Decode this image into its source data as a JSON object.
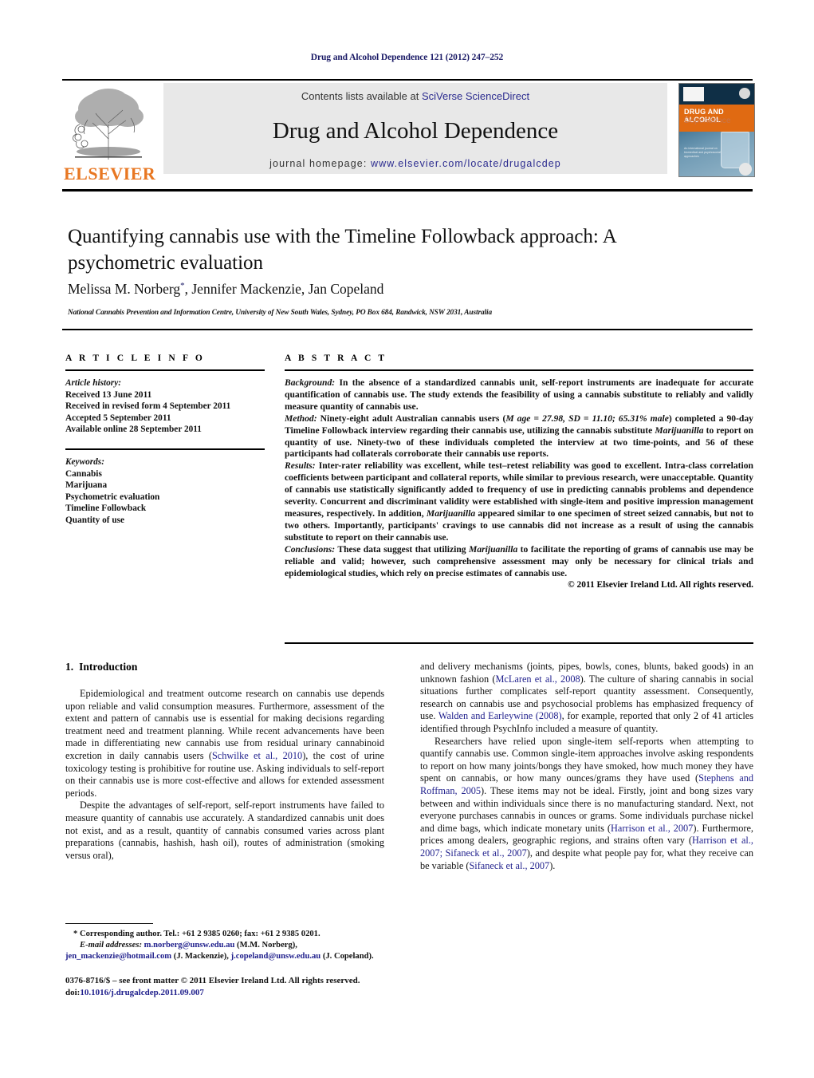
{
  "running_head": "Drug and Alcohol Dependence 121 (2012) 247–252",
  "masthead": {
    "contents_prefix": "Contents lists available at ",
    "contents_link": "SciVerse ScienceDirect",
    "journal_title": "Drug and Alcohol Dependence",
    "homepage_prefix": "journal homepage: ",
    "homepage_url": "www.elsevier.com/locate/drugalcdep",
    "publisher_logo_text": "ELSEVIER",
    "logo_icon": "elsevier-tree-icon"
  },
  "cover": {
    "title": "DRUG AND ALCOHOL",
    "subtitle": "Dependence",
    "small_text": "An international journal on biomedical and psychosocial approaches"
  },
  "article": {
    "title": "Quantifying cannabis use with the Timeline Followback approach: A psychometric evaluation",
    "authors": "Melissa M. Norberg",
    "authors_rest": ", Jennifer Mackenzie, Jan Copeland",
    "corresponding_marker": "*",
    "affiliation": "National Cannabis Prevention and Information Centre, University of New South Wales, Sydney, PO Box 684, Randwick, NSW 2031, Australia"
  },
  "info": {
    "heading": "A R T I C L E   I N F O",
    "history_label": "Article history:",
    "history": [
      "Received 13 June 2011",
      "Received in revised form 4 September 2011",
      "Accepted 5 September 2011",
      "Available online 28 September 2011"
    ],
    "keywords_label": "Keywords:",
    "keywords": [
      "Cannabis",
      "Marijuana",
      "Psychometric evaluation",
      "Timeline Followback",
      "Quantity of use"
    ]
  },
  "abstract": {
    "heading": "A B S T R A C T",
    "background_label": "Background:",
    "background": " In the absence of a standardized cannabis unit, self-report instruments are inadequate for accurate quantification of cannabis use. The study extends the feasibility of using a cannabis substitute to reliably and validly measure quantity of cannabis use.",
    "method_label": "Method:",
    "method_part1": " Ninety-eight adult Australian cannabis users (",
    "method_stats": "M age = 27.98, SD = 11.10; 65.31% male",
    "method_part2": ") completed a 90-day Timeline Followback interview regarding their cannabis use, utilizing the cannabis substitute ",
    "method_brand": "Marijuanilla",
    "method_part3": " to report on quantity of use. Ninety-two of these individuals completed the interview at two time-points, and 56 of these participants had collaterals corroborate their cannabis use reports.",
    "results_label": "Results:",
    "results_part1": " Inter-rater reliability was excellent, while test–retest reliability was good to excellent. Intra-class correlation coefficients between participant and collateral reports, while similar to previous research, were unacceptable. Quantity of cannabis use statistically significantly added to frequency of use in predicting cannabis problems and dependence severity. Concurrent and discriminant validity were established with single-item and positive impression management measures, respectively. In addition, ",
    "results_brand": "Marijuanilla",
    "results_part2": " appeared similar to one specimen of street seized cannabis, but not to two others. Importantly, participants' cravings to use cannabis did not increase as a result of using the cannabis substitute to report on their cannabis use.",
    "conclusions_label": "Conclusions:",
    "conclusions_part1": " These data suggest that utilizing ",
    "conclusions_brand": "Marijuanilla",
    "conclusions_part2": " to facilitate the reporting of grams of cannabis use may be reliable and valid; however, such comprehensive assessment may only be necessary for clinical trials and epidemiological studies, which rely on precise estimates of cannabis use.",
    "copyright": "© 2011 Elsevier Ireland Ltd. All rights reserved."
  },
  "body": {
    "section_number": "1.",
    "section_title": "Introduction",
    "left_p1_a": "Epidemiological and treatment outcome research on cannabis use depends upon reliable and valid consumption measures. Furthermore, assessment of the extent and pattern of cannabis use is essential for making decisions regarding treatment need and treatment planning. While recent advancements have been made in differentiating new cannabis use from residual urinary cannabinoid excretion in daily cannabis users (",
    "left_p1_ref1": "Schwilke et al., 2010",
    "left_p1_b": "), the cost of urine toxicology testing is prohibitive for routine use. Asking individuals to self-report on their cannabis use is more cost-effective and allows for extended assessment periods.",
    "left_p2": "Despite the advantages of self-report, self-report instruments have failed to measure quantity of cannabis use accurately. A standardized cannabis unit does not exist, and as a result, quantity of cannabis consumed varies across plant preparations (cannabis, hashish, hash oil), routes of administration (smoking versus oral),",
    "right_p1_a": "and delivery mechanisms (joints, pipes, bowls, cones, blunts, baked goods) in an unknown fashion (",
    "right_p1_ref1": "McLaren et al., 2008",
    "right_p1_b": "). The culture of sharing cannabis in social situations further complicates self-report quantity assessment. Consequently, research on cannabis use and psychosocial problems has emphasized frequency of use. ",
    "right_p1_ref2": "Walden and Earleywine (2008)",
    "right_p1_c": ", for example, reported that only 2 of 41 articles identified through PsychInfo included a measure of quantity.",
    "right_p2_a": "Researchers have relied upon single-item self-reports when attempting to quantify cannabis use. Common single-item approaches involve asking respondents to report on how many joints/bongs they have smoked, how much money they have spent on cannabis, or how many ounces/grams they have used (",
    "right_p2_ref1": "Stephens and Roffman, 2005",
    "right_p2_b": "). These items may not be ideal. Firstly, joint and bong sizes vary between and within individuals since there is no manufacturing standard. Next, not everyone purchases cannabis in ounces or grams. Some individuals purchase nickel and dime bags, which indicate monetary units (",
    "right_p2_ref2": "Harrison et al., 2007",
    "right_p2_c": "). Furthermore, prices among dealers, geographic regions, and strains often vary (",
    "right_p2_ref3": "Harrison et al., 2007; Sifaneck et al., 2007",
    "right_p2_d": "), and despite what people pay for, what they receive can be variable (",
    "right_p2_ref4": "Sifaneck et al., 2007",
    "right_p2_e": ")."
  },
  "footnotes": {
    "corresponding": "* Corresponding author. Tel.: +61 2 9385 0260; fax: +61 2 9385 0201.",
    "email_label": "E-mail addresses:",
    "email1": "m.norberg@unsw.edu.au",
    "email1_name": " (M.M. Norberg),",
    "email2": "jen_mackenzie@hotmail.com",
    "email2_name": " (J. Mackenzie),",
    "email3": "j.copeland@unsw.edu.au",
    "email3_name": " (J. Copeland).",
    "imprint_line1": "0376-8716/$ – see front matter © 2011 Elsevier Ireland Ltd. All rights reserved.",
    "imprint_doi_label": "doi:",
    "imprint_doi": "10.1016/j.drugalcdep.2011.09.007"
  },
  "colors": {
    "link": "#1f1f8c",
    "elsevier_orange": "#e87722",
    "masthead_bg": "#e8e8e8"
  }
}
